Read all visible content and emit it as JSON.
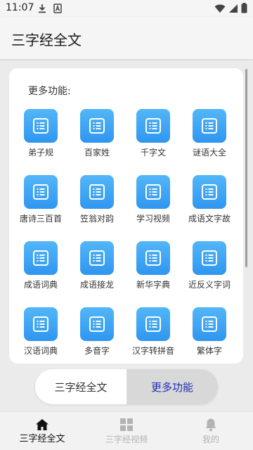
{
  "status_bar": {
    "time": "11:07",
    "left_icons": [
      "download-icon",
      "font-icon"
    ],
    "right_icons": [
      "wifi-icon",
      "signal-icon",
      "battery-icon"
    ]
  },
  "app_bar": {
    "title": "三字经全文"
  },
  "section": {
    "title": "更多功能:",
    "items": [
      {
        "label": "弟子规",
        "icon": "list-icon"
      },
      {
        "label": "百家姓",
        "icon": "list-icon"
      },
      {
        "label": "千字文",
        "icon": "list-icon"
      },
      {
        "label": "谜语大全",
        "icon": "list-icon"
      },
      {
        "label": "唐诗三百首",
        "icon": "list-icon"
      },
      {
        "label": "笠翁对韵",
        "icon": "list-icon"
      },
      {
        "label": "学习视频",
        "icon": "list-icon"
      },
      {
        "label": "成语文字故",
        "icon": "list-icon"
      },
      {
        "label": "成语词典",
        "icon": "list-icon"
      },
      {
        "label": "成语接龙",
        "icon": "list-icon"
      },
      {
        "label": "新华字典",
        "icon": "list-icon"
      },
      {
        "label": "近反义字词",
        "icon": "list-icon"
      },
      {
        "label": "汉语词典",
        "icon": "list-icon"
      },
      {
        "label": "多音字",
        "icon": "list-icon"
      },
      {
        "label": "汉字转拼音",
        "icon": "list-icon"
      },
      {
        "label": "繁体字",
        "icon": "list-icon"
      }
    ]
  },
  "toggle": {
    "left_label": "三字经全文",
    "right_label": "更多功能",
    "selected": "right"
  },
  "bottom_nav": {
    "items": [
      {
        "label": "三字经全文",
        "icon": "home-icon",
        "active": true
      },
      {
        "label": "三字经视频",
        "icon": "grid-icon",
        "active": false
      },
      {
        "label": "我的",
        "icon": "bell-icon",
        "active": false
      }
    ]
  },
  "colors": {
    "accent_blue": "#2f96f0",
    "toggle_selected_text": "#1e2fb5",
    "background": "#ebebeb"
  }
}
